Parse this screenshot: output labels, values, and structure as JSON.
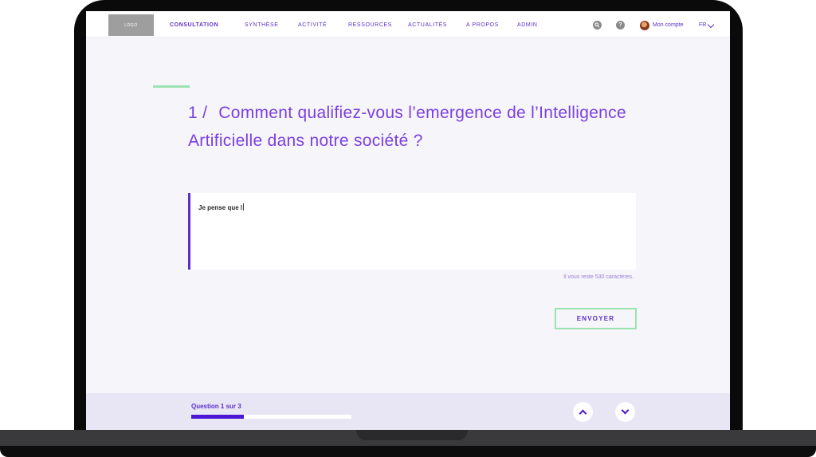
{
  "header": {
    "logo_text": "LOGO",
    "nav": [
      {
        "label": "CONSULTATION",
        "active": true
      },
      {
        "label": "SYNTHÈSE",
        "active": false
      },
      {
        "label": "ACTIVITÉ",
        "active": false
      },
      {
        "label": "RESSOURCES",
        "active": false
      },
      {
        "label": "ACTUALITÉS",
        "active": false
      },
      {
        "label": "A PROPOS",
        "active": false
      },
      {
        "label": "ADMIN",
        "active": false
      }
    ],
    "search_icon": "search-icon",
    "help_icon": "help-icon",
    "help_glyph": "?",
    "account_label": "Mon compte",
    "language": "FR"
  },
  "question": {
    "number": "1 /",
    "text": "Comment qualifiez-vous l’emergence de l’Intelligence Artificielle dans notre société ?"
  },
  "answer": {
    "value": "Je pense que l",
    "remaining": "Il vous reste 530 caractères."
  },
  "send_label": "ENVOYER",
  "progress": {
    "label": "Question 1 sur 3",
    "current": 1,
    "total": 3,
    "fraction": 0.33
  },
  "colors": {
    "accent": "#5b2fc8",
    "question": "#7b3fe0",
    "green": "#9be3b0",
    "progress": "#4a17d6"
  }
}
